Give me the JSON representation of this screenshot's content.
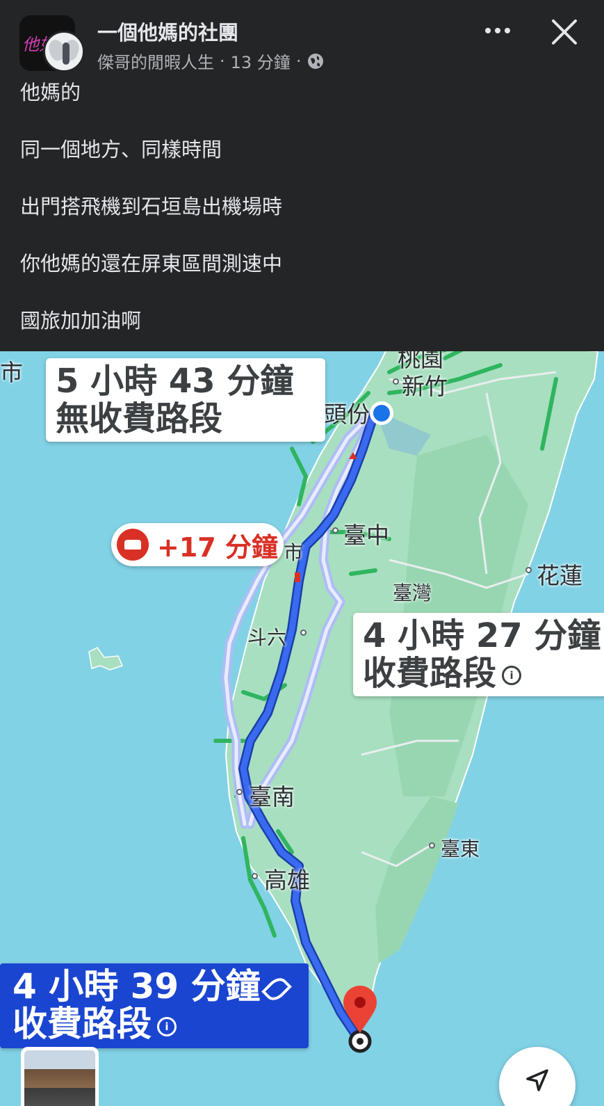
{
  "post": {
    "group_name": "一個他媽的社團",
    "author": "傑哥的閒暇人生",
    "separator": "·",
    "time_ago": "13 分鐘",
    "group_avatar_text": "他如",
    "lines": [
      "他媽的",
      "同一個地方、同樣時間",
      "出門搭飛機到石垣島出機場時",
      "你他媽的還在屏東區間測速中",
      "國旅加加油啊"
    ]
  },
  "icons": {
    "audience": "globe-icon",
    "more": "more-dots-icon",
    "close": "close-icon",
    "delay": "car-delay-icon",
    "info": "info-icon",
    "eco": "leaf-icon",
    "recenter": "navigation-arrow-icon",
    "destination": "map-pin-icon",
    "origin": "current-location-dot-icon"
  },
  "map": {
    "edge_label": "市",
    "routes": [
      {
        "duration": "5 小時 43 分鐘",
        "type": "無收費路段"
      },
      {
        "duration": "4 小時 27 分鐘",
        "type": "收費路段"
      },
      {
        "duration": "4 小時 39 分鐘",
        "type": "收費路段",
        "selected": true
      }
    ],
    "info_glyph": "①",
    "traffic_delay": "+17 分鐘",
    "places": {
      "hsinchu": "新竹",
      "toufen": "頭份",
      "taichung": "臺中",
      "hualien": "花蓮",
      "taiwan": "臺灣",
      "douliu": "斗六",
      "tainan": "臺南",
      "kaohsiung": "高雄",
      "taitung": "臺東",
      "taoyuan_partial": "桃園",
      "changhua_partial": "市"
    }
  },
  "colors": {
    "background": "#242526",
    "text": "#e4e6eb",
    "meta": "#b0b3b8",
    "sea": "#82d2e6",
    "land": "#a8dfc0",
    "route_selected": "#1a45d0",
    "route_alt": "#aebcf5",
    "delay_red": "#d93025",
    "highway_green": "#2fb55f"
  }
}
